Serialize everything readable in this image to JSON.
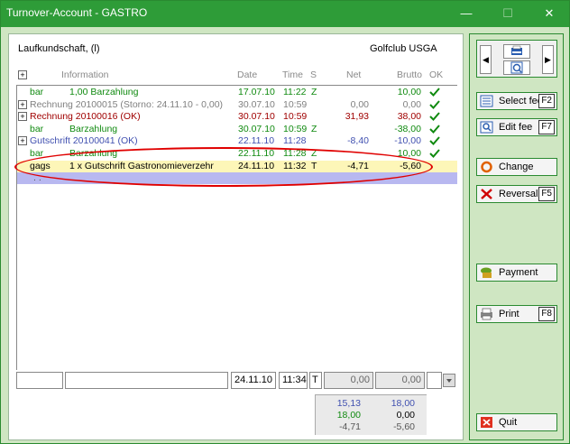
{
  "window": {
    "title": "Turnover-Account - GASTRO",
    "minimize": "—",
    "maximize": "☐",
    "close": "✕"
  },
  "header": {
    "customer": "Laufkundschaft, (l)",
    "club": "Golfclub USGA"
  },
  "columns": {
    "information": "Information",
    "date": "Date",
    "time": "Time",
    "s": "S",
    "net": "Net",
    "brutto": "Brutto",
    "ok": "OK"
  },
  "rows": [
    {
      "prefix": "bar",
      "info": "1,00 Barzahlung",
      "date": "17.07.10",
      "time": "11:22",
      "s": "Z",
      "net": "",
      "brutto": "10,00",
      "ok": true,
      "color": "#108a10",
      "expand": false
    },
    {
      "prefix": "",
      "info": "Rechnung 20100015 (Storno: 24.11.10 - 0,00)",
      "date": "30.07.10",
      "time": "10:59",
      "s": "",
      "net": "0,00",
      "brutto": "0,00",
      "ok": true,
      "color": "#808080",
      "expand": true
    },
    {
      "prefix": "",
      "info": "Rechnung 20100016 (OK)",
      "date": "30.07.10",
      "time": "10:59",
      "s": "",
      "net": "31,93",
      "brutto": "38,00",
      "ok": true,
      "color": "#a00000",
      "expand": true
    },
    {
      "prefix": "bar",
      "info": "Barzahlung",
      "date": "30.07.10",
      "time": "10:59",
      "s": "Z",
      "net": "",
      "brutto": "-38,00",
      "ok": true,
      "color": "#108a10",
      "expand": false
    },
    {
      "prefix": "",
      "info": "Gutschrift 20100041 (OK)",
      "date": "22.11.10",
      "time": "11:28",
      "s": "",
      "net": "-8,40",
      "brutto": "-10,00",
      "ok": true,
      "color": "#4050b0",
      "expand": true
    },
    {
      "prefix": "bar",
      "info": "Barzahlung",
      "date": "22.11.10",
      "time": "11:28",
      "s": "Z",
      "net": "",
      "brutto": "10,00",
      "ok": true,
      "color": "#108a10",
      "expand": false
    },
    {
      "prefix": "gags",
      "info": "1 x Gutschrift Gastronomieverzehr",
      "date": "24.11.10",
      "time": "11:32",
      "s": "T",
      "net": "-4,71",
      "brutto": "-5,60",
      "ok": false,
      "color": "#000000",
      "expand": false,
      "selected": true
    }
  ],
  "placeholder_row": ". .",
  "input": {
    "code": "",
    "text": "",
    "date": "24.11.10",
    "time": "11:34",
    "s": "T",
    "net": "0,00",
    "brutto": "0,00"
  },
  "totals": {
    "row1": {
      "net": "15,13",
      "brutto": "18,00"
    },
    "row2": {
      "net": "18,00",
      "brutto": "0,00"
    },
    "row3": {
      "net": "-4,71",
      "brutto": "-5,60"
    }
  },
  "buttons": {
    "select_fee": {
      "label": "Select fee",
      "key": "F2"
    },
    "edit_fee": {
      "label": "Edit fee",
      "key": "F7"
    },
    "change": {
      "label": "Change"
    },
    "reversal": {
      "label": "Reversal",
      "key": "F5"
    },
    "payment": {
      "label": "Payment"
    },
    "print": {
      "label": "Print",
      "key": "F8"
    },
    "quit": {
      "label": "Quit"
    }
  },
  "colors": {
    "titlebar": "#2e9c38",
    "frame": "#cfe6c2",
    "highlight": "#e00000",
    "selected_row": "#fdf6b8",
    "cursor_row": "#b8b8f0"
  }
}
